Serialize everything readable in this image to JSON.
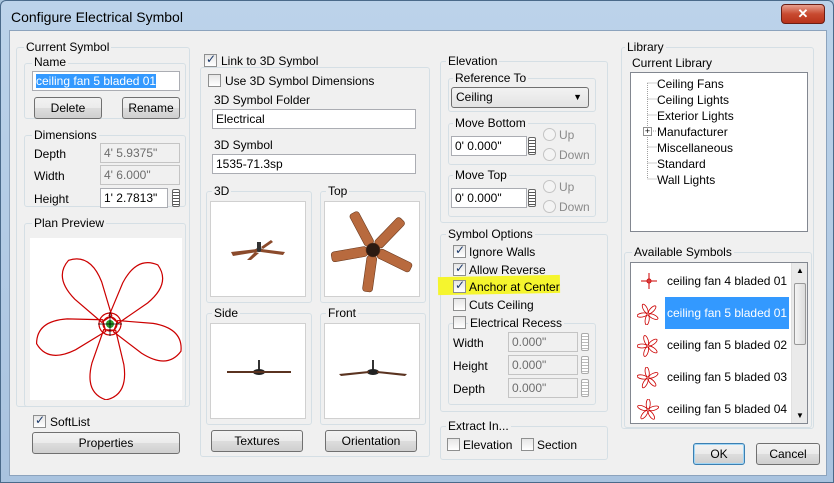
{
  "window": {
    "title": "Configure Electrical Symbol",
    "close_label": "✕"
  },
  "current_symbol": {
    "group": "Current Symbol",
    "name_label": "Name",
    "name_value": "ceiling fan 5 bladed 01",
    "delete": "Delete",
    "rename": "Rename"
  },
  "dimensions": {
    "group": "Dimensions",
    "depth_label": "Depth",
    "depth_value": "4' 5.9375\"",
    "width_label": "Width",
    "width_value": "4' 6.000\"",
    "height_label": "Height",
    "height_value": "1' 2.7813\""
  },
  "plan_preview": {
    "group": "Plan Preview"
  },
  "softlist": {
    "label": "SoftList",
    "checked": true,
    "properties": "Properties"
  },
  "symbol3d": {
    "link_label": "Link to 3D Symbol",
    "link_checked": true,
    "use_dims_label": "Use 3D Symbol Dimensions",
    "use_dims_checked": false,
    "folder_label": "3D Symbol Folder",
    "folder_value": "Electrical",
    "symbol_label": "3D Symbol",
    "symbol_value": "1535-71.3sp",
    "view_3d": "3D",
    "view_top": "Top",
    "view_side": "Side",
    "view_front": "Front",
    "textures": "Textures",
    "orientation": "Orientation"
  },
  "elevation": {
    "group": "Elevation",
    "ref_group": "Reference To",
    "ref_value": "Ceiling",
    "bottom_group": "Move Bottom",
    "bottom_value": "0' 0.000\"",
    "top_group": "Move Top",
    "top_value": "0' 0.000\"",
    "up": "Up",
    "down": "Down"
  },
  "symbol_options": {
    "group": "Symbol Options",
    "ignore_walls": "Ignore Walls",
    "allow_reverse": "Allow Reverse",
    "anchor_center": "Anchor at Center",
    "cuts_ceiling": "Cuts Ceiling",
    "electrical_recess": "Electrical Recess",
    "width_label": "Width",
    "width_value": "0.000\"",
    "height_label": "Height",
    "height_value": "0.000\"",
    "depth_label": "Depth",
    "depth_value": "0.000\""
  },
  "extract": {
    "group": "Extract In...",
    "elevation": "Elevation",
    "section": "Section"
  },
  "library": {
    "group": "Library",
    "current_label": "Current Library",
    "tree": [
      "Ceiling Fans",
      "Ceiling Lights",
      "Exterior Lights",
      "Manufacturer",
      "Miscellaneous",
      "Standard",
      "Wall Lights"
    ],
    "available_group": "Available Symbols",
    "symbols": [
      "ceiling fan 4 bladed 01",
      "ceiling fan 5 bladed 01",
      "ceiling fan 5 bladed 02",
      "ceiling fan 5 bladed 03",
      "ceiling fan 5 bladed 04"
    ]
  },
  "footer": {
    "ok": "OK",
    "cancel": "Cancel"
  },
  "colors": {
    "highlight": "#f5f52e",
    "selection": "#3399ff",
    "plan_red": "#cc0000",
    "fan_brown": "#8b4a2b"
  }
}
